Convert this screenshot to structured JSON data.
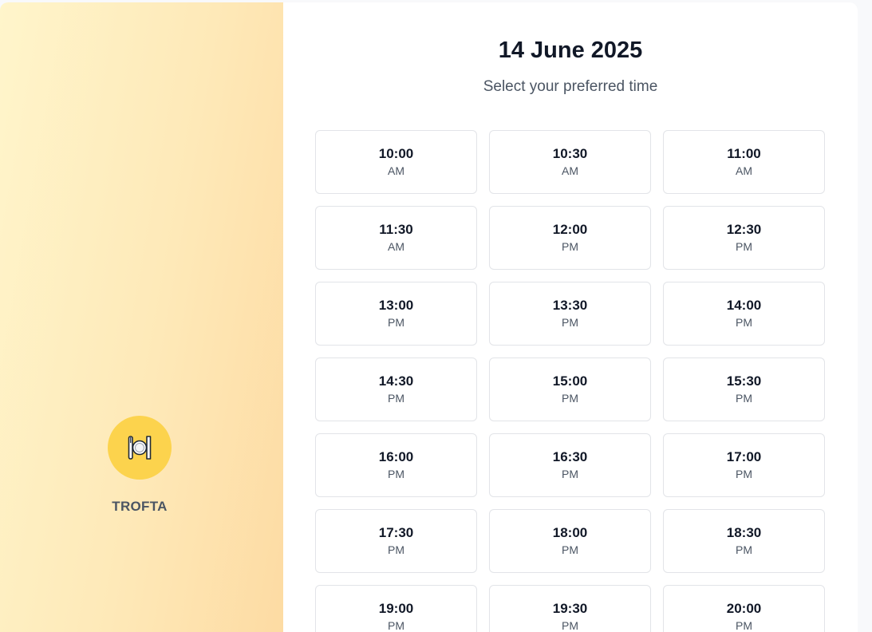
{
  "brand": {
    "name": "TROFTA",
    "icon": "plate-with-cutlery-icon",
    "accent": "#fcd34d"
  },
  "header": {
    "date": "14 June 2025",
    "subtitle": "Select your preferred time"
  },
  "slots": [
    {
      "time": "10:00",
      "period": "AM"
    },
    {
      "time": "10:30",
      "period": "AM"
    },
    {
      "time": "11:00",
      "period": "AM"
    },
    {
      "time": "11:30",
      "period": "AM"
    },
    {
      "time": "12:00",
      "period": "PM"
    },
    {
      "time": "12:30",
      "period": "PM"
    },
    {
      "time": "13:00",
      "period": "PM"
    },
    {
      "time": "13:30",
      "period": "PM"
    },
    {
      "time": "14:00",
      "period": "PM"
    },
    {
      "time": "14:30",
      "period": "PM"
    },
    {
      "time": "15:00",
      "period": "PM"
    },
    {
      "time": "15:30",
      "period": "PM"
    },
    {
      "time": "16:00",
      "period": "PM"
    },
    {
      "time": "16:30",
      "period": "PM"
    },
    {
      "time": "17:00",
      "period": "PM"
    },
    {
      "time": "17:30",
      "period": "PM"
    },
    {
      "time": "18:00",
      "period": "PM"
    },
    {
      "time": "18:30",
      "period": "PM"
    },
    {
      "time": "19:00",
      "period": "PM"
    },
    {
      "time": "19:30",
      "period": "PM"
    },
    {
      "time": "20:00",
      "period": "PM"
    }
  ]
}
